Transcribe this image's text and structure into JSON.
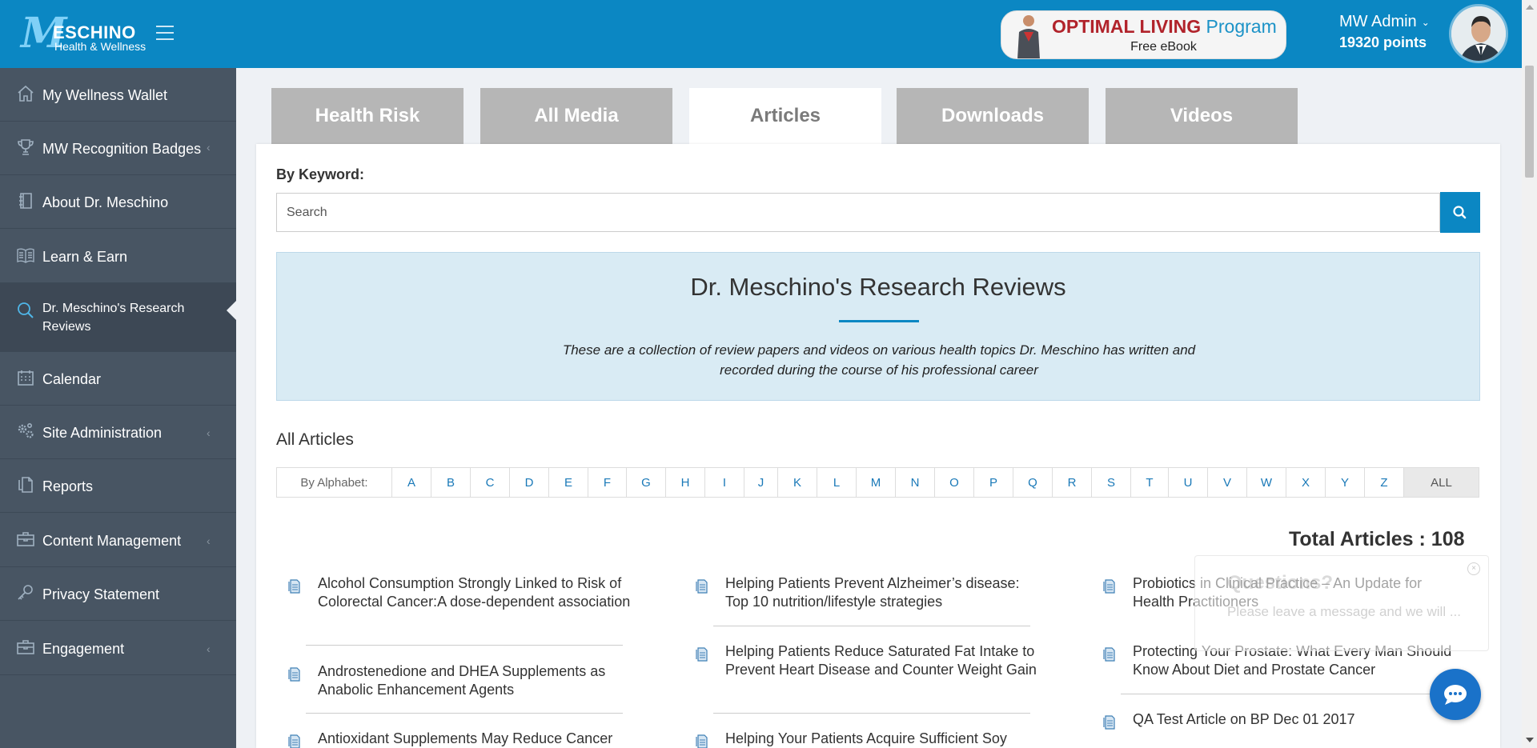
{
  "header": {
    "logo": {
      "line1": "ESCHINO",
      "line2": "Health & Wellness",
      "mark": "M"
    },
    "promo": {
      "brand": "OPTIMAL LIVING",
      "suffix": "Program",
      "subtitle": "Free eBook"
    },
    "user": {
      "name": "MW Admin",
      "points": "19320 points"
    },
    "colors": {
      "bar": "#0b87c3",
      "sidebar": "#485563"
    }
  },
  "sidebar": {
    "items": [
      {
        "label": "My Wellness Wallet",
        "icon": "home-icon",
        "submenu": false
      },
      {
        "label": "MW Recognition Badges",
        "icon": "trophy-icon",
        "submenu": true
      },
      {
        "label": "About Dr. Meschino",
        "icon": "book-icon",
        "submenu": false
      },
      {
        "label": "Learn & Earn",
        "icon": "open-book-icon",
        "submenu": false
      },
      {
        "label": "Dr. Meschino's Research Reviews",
        "icon": "search-icon",
        "submenu": false,
        "active": true
      },
      {
        "label": "Calendar",
        "icon": "calendar-icon",
        "submenu": false
      },
      {
        "label": "Site Administration",
        "icon": "gears-icon",
        "submenu": true
      },
      {
        "label": "Reports",
        "icon": "reports-icon",
        "submenu": false
      },
      {
        "label": "Content Management",
        "icon": "briefcase-icon",
        "submenu": true
      },
      {
        "label": "Privacy Statement",
        "icon": "key-icon",
        "submenu": false
      },
      {
        "label": "Engagement",
        "icon": "briefcase-icon",
        "submenu": true
      }
    ]
  },
  "tabs": [
    {
      "label": "Health Risk"
    },
    {
      "label": "All Media"
    },
    {
      "label": "Articles",
      "active": true
    },
    {
      "label": "Downloads"
    },
    {
      "label": "Videos"
    }
  ],
  "search": {
    "label": "By Keyword:",
    "placeholder": "Search"
  },
  "banner": {
    "title": "Dr. Meschino's Research Reviews",
    "description": "These are a collection of review papers and videos on various health topics Dr. Meschino has written and recorded during the course of his professional career"
  },
  "articles_section": {
    "title": "All Articles",
    "alphabet_label": "By Alphabet:",
    "letters": [
      "A",
      "B",
      "C",
      "D",
      "E",
      "F",
      "G",
      "H",
      "I",
      "J",
      "K",
      "L",
      "M",
      "N",
      "O",
      "P",
      "Q",
      "R",
      "S",
      "T",
      "U",
      "V",
      "W",
      "X",
      "Y",
      "Z"
    ],
    "all_label": "ALL",
    "total": "Total Articles : 108",
    "columns": [
      [
        "Alcohol Consumption Strongly Linked to Risk of Colorectal Cancer:A dose-dependent association",
        "Androstenedione and DHEA Supplements as Anabolic Enhancement Agents",
        "Antioxidant Supplements May Reduce Cancer"
      ],
      [
        "Helping Patients Prevent Alzheimer’s disease: Top 10 nutrition/lifestyle strategies",
        "Helping Patients Reduce Saturated Fat Intake to Prevent Heart Disease and Counter Weight Gain",
        "Helping Your Patients Acquire Sufficient Soy"
      ],
      [
        "Probiotics in Clinical Practice – An Update for Health Practitioners",
        "Protecting Your Prostate: What Every Man Should Know About Diet and Prostate Cancer",
        "QA Test Article on BP Dec 01 2017"
      ]
    ]
  },
  "chat": {
    "title": "Questions?",
    "message": "Please leave a message and we will ...",
    "close": "×"
  }
}
